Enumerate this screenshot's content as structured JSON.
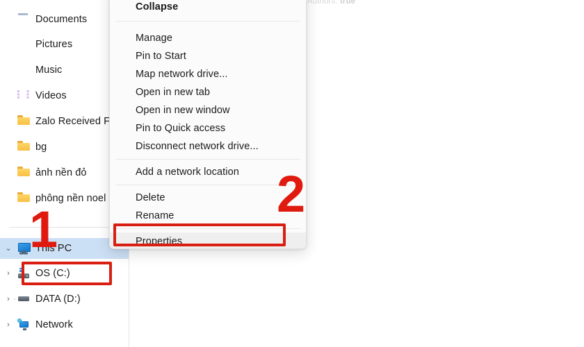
{
  "window": {
    "clipped_top_text_prefix": "Authors: ",
    "clipped_top_text_bold": "true"
  },
  "nav_pane": {
    "items": [
      {
        "label": "Documents",
        "icon": "document-icon",
        "chevron": "",
        "indent": 1
      },
      {
        "label": "Pictures",
        "icon": "pictures-icon",
        "chevron": "",
        "indent": 1
      },
      {
        "label": "Music",
        "icon": "music-icon",
        "chevron": "",
        "indent": 1
      },
      {
        "label": "Videos",
        "icon": "videos-icon",
        "chevron": "",
        "indent": 1
      },
      {
        "label": "Zalo Received Fi",
        "icon": "folder-icon",
        "chevron": "",
        "indent": 1
      },
      {
        "label": "bg",
        "icon": "folder-icon",
        "chevron": "",
        "indent": 1
      },
      {
        "label": "ảnh nền đỏ",
        "icon": "folder-icon",
        "chevron": "",
        "indent": 1
      },
      {
        "label": "phông nền noel",
        "icon": "folder-icon",
        "chevron": "",
        "indent": 1
      },
      {
        "label": "This PC",
        "icon": "this-pc-icon",
        "chevron": "⌄",
        "indent": 0,
        "selected": true
      },
      {
        "label": "OS (C:)",
        "icon": "drive-os-icon",
        "chevron": "›",
        "indent": 1
      },
      {
        "label": "DATA (D:)",
        "icon": "drive-icon",
        "chevron": "›",
        "indent": 1
      },
      {
        "label": "Network",
        "icon": "network-icon",
        "chevron": "›",
        "indent": 0
      }
    ]
  },
  "context_menu": {
    "header": "Collapse",
    "items": [
      {
        "label": "Manage"
      },
      {
        "label": "Pin to Start"
      },
      {
        "label": "Map network drive..."
      },
      {
        "label": "Open in new tab"
      },
      {
        "label": "Open in new window"
      },
      {
        "label": "Pin to Quick access"
      },
      {
        "label": "Disconnect network drive..."
      },
      {
        "label": "Add a network location"
      },
      {
        "label": "Delete"
      },
      {
        "label": "Rename"
      },
      {
        "label": "Properties"
      }
    ]
  },
  "annotations": {
    "step_one": "1",
    "step_two": "2",
    "accent_color": "#e01a0e"
  }
}
